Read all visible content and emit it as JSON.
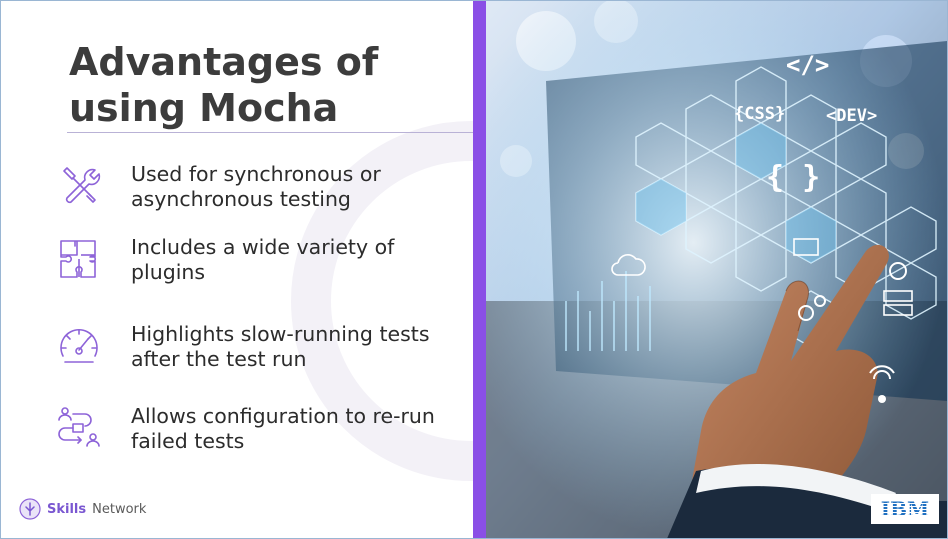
{
  "slide": {
    "title": "Advantages of using Mocha",
    "features": [
      {
        "icon": "tools-icon",
        "text": "Used for synchronous or asynchronous testing"
      },
      {
        "icon": "puzzle-icon",
        "text": "Includes a wide variety of plugins"
      },
      {
        "icon": "speedometer-icon",
        "text": "Highlights slow-running tests after the test run"
      },
      {
        "icon": "workflow-icon",
        "text": "Allows configuration to re-run failed tests"
      }
    ],
    "brand": {
      "strong": "Skills",
      "rest": "Network"
    },
    "photo": {
      "labels": [
        "</>",
        "{CSS}",
        "<DEV>",
        "{ }"
      ]
    },
    "logo": "IBM"
  },
  "colors": {
    "accent": "#8a4fe6",
    "icon_stroke": "#8d63d8",
    "title": "#3c3c3c",
    "text": "#2c2c2c"
  }
}
